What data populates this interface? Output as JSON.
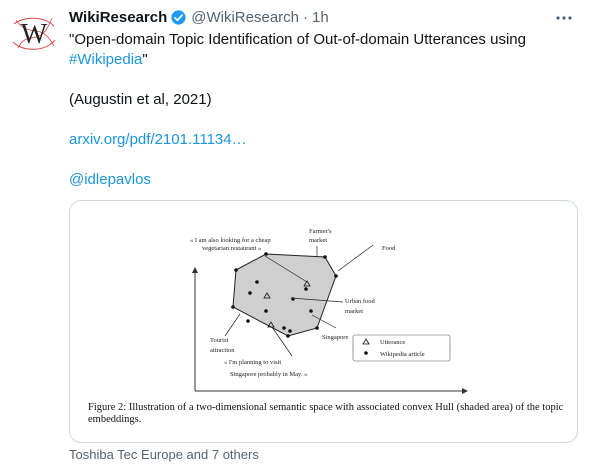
{
  "account": {
    "name": "WikiResearch",
    "handle": "@WikiResearch",
    "separator": "·",
    "time": "1h",
    "avatar_icon": "wikipedia-logo-icon",
    "avatar_letter": "W",
    "verified_icon": "verified-badge-icon",
    "verified_color": "#1d9bf0"
  },
  "tweet": {
    "title_line1": "\"Open-domain Topic Identification of Out-of-domain Utterances using",
    "title_hashtag": "#Wikipedia",
    "title_end": "\"",
    "citation": "(Augustin et al, 2021)",
    "link": "arxiv.org/pdf/2101.11134…",
    "mention": "@idlepavlos",
    "link_color": "#1b95e0"
  },
  "figure": {
    "quote1_line1": "« I am also looking for a cheap",
    "quote1_line2": "vegetarian restaurant »",
    "farmers_line1": "Farmer's",
    "farmers_line2": "market",
    "food": "Food",
    "urban_line1": "Urban food",
    "urban_line2": "market",
    "singapore": "Singapore",
    "tourist_line1": "Tourist",
    "tourist_line2": "attraction",
    "quote2_line1": "« I'm planning to visit",
    "quote2_line2": "Singapore probably in May. »",
    "legend_utterance": "Utterance",
    "legend_article": "Wikipedia article",
    "caption": "Figure 2: Illustration of a two-dimensional semantic space with associated convex Hull (shaded area) of the topic embeddings."
  },
  "footer": {
    "likes_text": "Toshiba Tec Europe and 7 others"
  },
  "more_icon": "more-options-icon"
}
